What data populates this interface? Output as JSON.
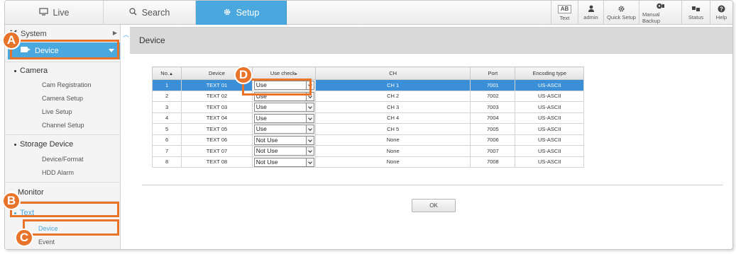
{
  "tabs": [
    {
      "label": "Live",
      "icon": "monitor-icon"
    },
    {
      "label": "Search",
      "icon": "search-icon"
    },
    {
      "label": "Setup",
      "icon": "gear-icon"
    }
  ],
  "toolbar": {
    "text_badge": "AB",
    "text_label": "Text",
    "admin_label": "admin",
    "quick_label": "Quick Setup",
    "backup_label": "Manual Backup",
    "status_label": "Status",
    "help_label": "Help"
  },
  "sidebar": {
    "system_label": "System",
    "device_label": "Device",
    "camera_group": "Camera",
    "camera_items": [
      "Cam Registration",
      "Camera Setup",
      "Live Setup",
      "Channel Setup"
    ],
    "storage_group": "Storage Device",
    "storage_items": [
      "Device/Format",
      "HDD Alarm"
    ],
    "monitor_label": "Monitor",
    "text_group": "Text",
    "text_items": [
      "Device",
      "Event"
    ]
  },
  "page": {
    "title": "Device",
    "ok_label": "OK"
  },
  "table": {
    "headers": [
      "No.",
      "Device",
      "Use check",
      "CH",
      "Port",
      "Encoding type"
    ],
    "rows": [
      {
        "no": "1",
        "device": "TEXT 01",
        "use": "Use",
        "ch": "CH 1",
        "port": "7001",
        "enc": "US-ASCII"
      },
      {
        "no": "2",
        "device": "TEXT 02",
        "use": "Use",
        "ch": "CH 2",
        "port": "7002",
        "enc": "US-ASCII"
      },
      {
        "no": "3",
        "device": "TEXT 03",
        "use": "Use",
        "ch": "CH 3",
        "port": "7003",
        "enc": "US-ASCII"
      },
      {
        "no": "4",
        "device": "TEXT 04",
        "use": "Use",
        "ch": "CH 4",
        "port": "7004",
        "enc": "US-ASCII"
      },
      {
        "no": "5",
        "device": "TEXT 05",
        "use": "Use",
        "ch": "CH 5",
        "port": "7005",
        "enc": "US-ASCII"
      },
      {
        "no": "6",
        "device": "TEXT 06",
        "use": "Not Use",
        "ch": "None",
        "port": "7006",
        "enc": "US-ASCII"
      },
      {
        "no": "7",
        "device": "TEXT 07",
        "use": "Not Use",
        "ch": "None",
        "port": "7007",
        "enc": "US-ASCII"
      },
      {
        "no": "8",
        "device": "TEXT 08",
        "use": "Not Use",
        "ch": "None",
        "port": "7008",
        "enc": "US-ASCII"
      }
    ]
  },
  "callouts": [
    "A",
    "B",
    "C",
    "D"
  ],
  "colors": {
    "accent": "#4aa8de",
    "callout": "#e8732a",
    "selected_row": "#3b8fd6"
  }
}
